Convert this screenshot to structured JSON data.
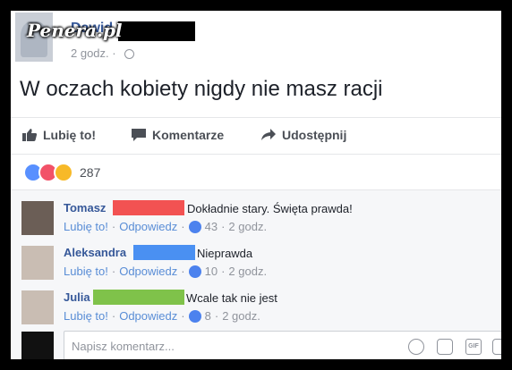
{
  "watermark": "Penera.pl",
  "post": {
    "author": "Dawid",
    "time": "2 godz. ·",
    "text": "W oczach kobiety nigdy nie masz racji"
  },
  "actions": {
    "like": "Lubię to!",
    "comment": "Komentarze",
    "share": "Udostępnij"
  },
  "reactions": {
    "count": "287"
  },
  "comments": [
    {
      "name": "Tomasz",
      "text": "Dokładnie stary. Święta prawda!",
      "like": "Lubię to!",
      "reply": "Odpowiedz",
      "likes": "43",
      "time": "2 godz.",
      "redact_color": "#f25252"
    },
    {
      "name": "Aleksandra",
      "text": "Nieprawda",
      "like": "Lubię to!",
      "reply": "Odpowiedz",
      "likes": "10",
      "time": "2 godz.",
      "redact_color": "#4a90f2"
    },
    {
      "name": "Julia",
      "text": "Wcale tak nie jest",
      "like": "Lubię to!",
      "reply": "Odpowiedz",
      "likes": "8",
      "time": "2 godz.",
      "redact_color": "#7fc24a"
    }
  ],
  "composer": {
    "placeholder": "Napisz komentarz..."
  },
  "composer_icons": [
    "emoji-icon",
    "camera-icon",
    "gif-icon",
    "sticker-icon"
  ]
}
